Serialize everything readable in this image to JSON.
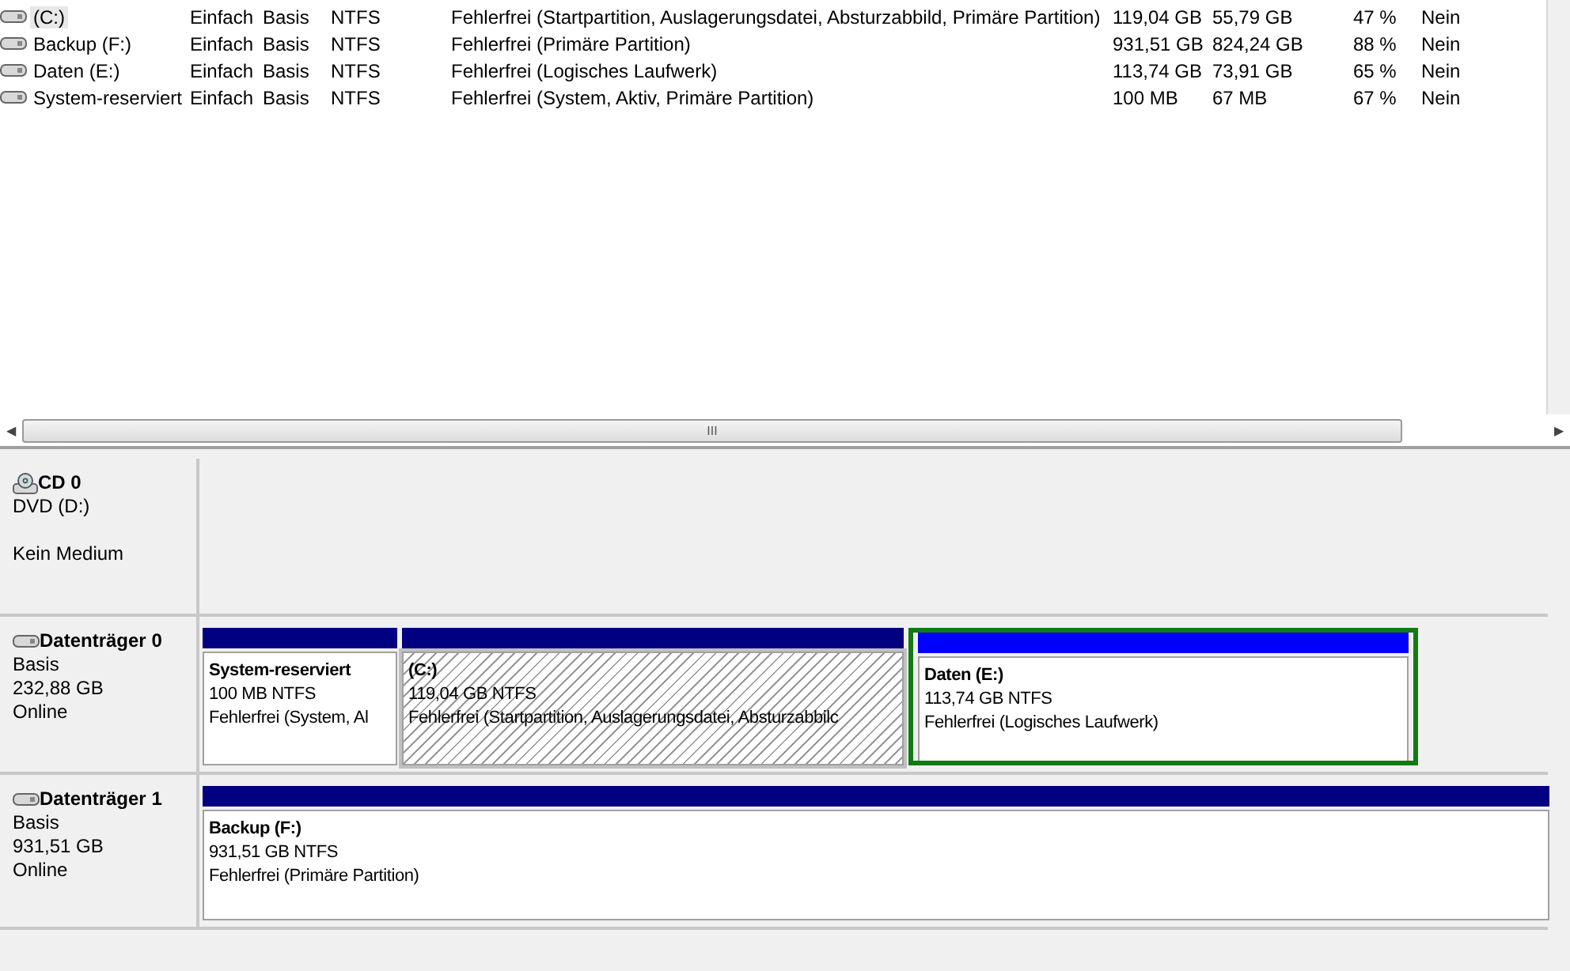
{
  "volumes": [
    {
      "name": "(C:)",
      "layout": "Einfach",
      "type": "Basis",
      "file_system": "NTFS",
      "status": "Fehlerfrei (Startpartition, Auslagerungsdatei, Absturzabbild, Primäre Partition)",
      "capacity": "119,04 GB",
      "free": "55,79 GB",
      "percent_free": "47 %",
      "fault_tolerance": "Nein",
      "selected": true
    },
    {
      "name": "Backup (F:)",
      "layout": "Einfach",
      "type": "Basis",
      "file_system": "NTFS",
      "status": "Fehlerfrei (Primäre Partition)",
      "capacity": "931,51 GB",
      "free": "824,24 GB",
      "percent_free": "88 %",
      "fault_tolerance": "Nein",
      "selected": false
    },
    {
      "name": "Daten (E:)",
      "layout": "Einfach",
      "type": "Basis",
      "file_system": "NTFS",
      "status": "Fehlerfrei (Logisches Laufwerk)",
      "capacity": "113,74 GB",
      "free": "73,91 GB",
      "percent_free": "65 %",
      "fault_tolerance": "Nein",
      "selected": false
    },
    {
      "name": "System-reserviert",
      "layout": "Einfach",
      "type": "Basis",
      "file_system": "NTFS",
      "status": "Fehlerfrei (System, Aktiv, Primäre Partition)",
      "capacity": "100 MB",
      "free": "67 MB",
      "percent_free": "67 %",
      "fault_tolerance": "Nein",
      "selected": false
    }
  ],
  "horizontal_scrollbar": {
    "left_arrow": "◀",
    "grip": "III",
    "right_arrow": "▶"
  },
  "disks": [
    {
      "kind": "cdrom",
      "name": "CD 0",
      "lines": [
        "DVD (D:)",
        "Kein Medium"
      ]
    },
    {
      "kind": "disk",
      "name": "Datenträger 0",
      "lines": [
        "Basis",
        "232,88 GB",
        "Online"
      ],
      "partitions": [
        {
          "kind": "primary",
          "name": "System-reserviert",
          "size": "100 MB NTFS",
          "status": "Fehlerfrei (System, Al",
          "hatched": false,
          "selected": false
        },
        {
          "kind": "primary",
          "name": "(C:)",
          "size": "119,04 GB NTFS",
          "status": "Fehlerfrei (Startpartition, Auslagerungsdatei, Absturzabbilc",
          "hatched": true,
          "selected": false
        },
        {
          "kind": "logical",
          "name": "Daten  (E:)",
          "size": "113,74 GB NTFS",
          "status": "Fehlerfrei (Logisches Laufwerk)",
          "hatched": false,
          "selected": false
        }
      ]
    },
    {
      "kind": "disk",
      "name": "Datenträger 1",
      "lines": [
        "Basis",
        "931,51 GB",
        "Online"
      ],
      "partitions": [
        {
          "kind": "primary",
          "name": "Backup  (F:)",
          "size": "931,51 GB NTFS",
          "status": "Fehlerfrei (Primäre Partition)",
          "hatched": false,
          "selected": false
        }
      ]
    }
  ]
}
